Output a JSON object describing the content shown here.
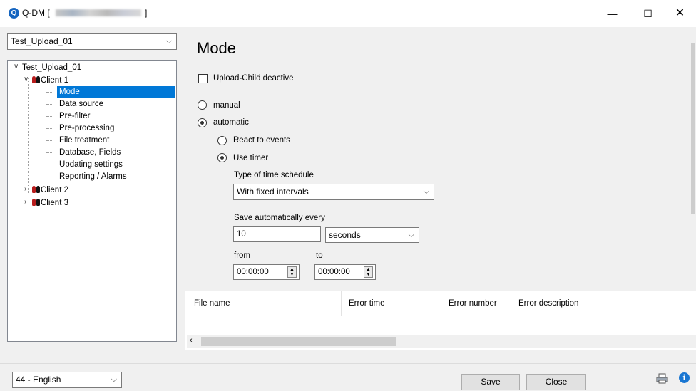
{
  "window": {
    "title": "Q-DM [",
    "title_suffix": "]",
    "minimize": "—",
    "maximize": "☐",
    "close": "✕"
  },
  "project_combo": {
    "value": "Test_Upload_01"
  },
  "tree": {
    "root": "Test_Upload_01",
    "client1": "Client 1",
    "client1_children": [
      "Mode",
      "Data source",
      "Pre-filter",
      "Pre-processing",
      "File treatment",
      "Database, Fields",
      "Updating settings",
      "Reporting / Alarms"
    ],
    "client2": "Client 2",
    "client3": "Client 3",
    "selected": "Mode"
  },
  "mode_panel": {
    "title": "Mode",
    "upload_child_label": "Upload-Child deactive",
    "upload_child_checked": false,
    "manual_label": "manual",
    "automatic_label": "automatic",
    "mode_selected": "automatic",
    "react_label": "React to events",
    "timer_label": "Use timer",
    "trigger_selected": "Use timer",
    "schedule_type_label": "Type of time schedule",
    "schedule_type_value": "With fixed intervals",
    "save_every_label": "Save automatically every",
    "save_every_value": "10",
    "unit_value": "seconds",
    "from_label": "from",
    "to_label": "to",
    "from_value": "00:00:00",
    "to_value": "00:00:00"
  },
  "error_grid": {
    "columns": [
      "File name",
      "Error time",
      "Error number",
      "Error description"
    ],
    "rows": []
  },
  "bottom": {
    "language": "44 - English",
    "save_label": "Save",
    "close_label": "Close"
  },
  "icons": {
    "app": "app-icon",
    "printer": "printer-icon",
    "info": "info-icon"
  },
  "colors": {
    "selection": "#0078d7",
    "info": "#1976d2"
  }
}
